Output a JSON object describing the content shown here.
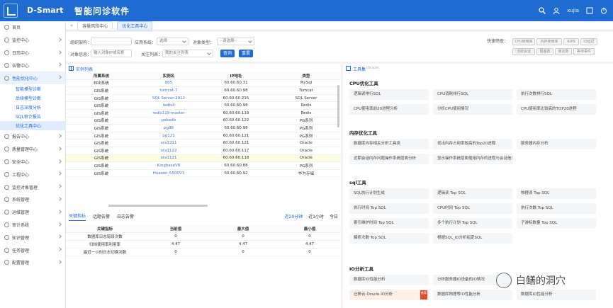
{
  "topbar": {
    "brand": "D-Smart",
    "title": "智能问诊软件",
    "user": "xujia"
  },
  "sidebar": {
    "items": [
      {
        "label": "首页"
      },
      {
        "label": "监控中心"
      },
      {
        "label": "日志中心"
      },
      {
        "label": "告警中心"
      },
      {
        "label": "性能优化中心",
        "active": true
      },
      {
        "label": "报告中心"
      },
      {
        "label": "质量管理中心"
      },
      {
        "label": "安全中心"
      },
      {
        "label": "工程中心"
      },
      {
        "label": "监控对象管理"
      },
      {
        "label": "系统管理"
      },
      {
        "label": "运维管理"
      },
      {
        "label": "审计系统"
      },
      {
        "label": "知识管理"
      },
      {
        "label": "任务管理"
      },
      {
        "label": "配置管理"
      }
    ],
    "subitems": [
      {
        "label": "智能模型诊断"
      },
      {
        "label": "后续模型诊断"
      },
      {
        "label": "日志深度分析"
      },
      {
        "label": "SQL审计报告"
      },
      {
        "label": "优化工具中心",
        "active": true
      }
    ]
  },
  "tabs": [
    {
      "label": "容量风险中心"
    },
    {
      "label": "优化工具中心",
      "active": true
    }
  ],
  "filters": {
    "org_label": "组织架构：",
    "app_label": "应用系统：",
    "app_value": "选择",
    "type_label": "对象类型：",
    "type_value": "--请选择--",
    "obj_label": "对象信息：",
    "obj_placeholder": "输入对象IP或名称",
    "focus_label": "关注列表：",
    "focus_value": "我的关注列表",
    "query_btn": "查询",
    "reset_btn": "重置",
    "quick_label": "快速筛查：",
    "quick": [
      "CPU使用率",
      "内存使用率",
      "IOPS",
      "IO延迟",
      "活跃会话",
      "阻塞数",
      "锁定数",
      "等待事件"
    ]
  },
  "instance_list": {
    "title": "实例列表",
    "headers": [
      "所属系统",
      "实例名",
      "IP地址",
      "类型"
    ],
    "rows": [
      [
        "ERP系统",
        "db5",
        "60.60.60.31",
        "MySql"
      ],
      [
        "GIS系统",
        "tomcat-7",
        "60.60.60.98",
        "Tomcat"
      ],
      [
        "GIS系统",
        "SQL Server-2012",
        "60.60.60.215",
        "SQL Server"
      ],
      [
        "GIS系统",
        "redis4",
        "60.60.60.98",
        "Redis"
      ],
      [
        "GIS系统",
        "redis119-master",
        "60.60.60.119",
        "Redis"
      ],
      [
        "GIS系统",
        "pekedb",
        "60.60.60.122",
        "PG系列"
      ],
      [
        "GIS系统",
        "pg98",
        "60.60.60.98",
        "PG系列"
      ],
      [
        "GIS系统",
        "pg121",
        "60.60.60.121",
        "PG系列"
      ],
      [
        "GIS系统",
        "ora1211",
        "60.60.60.121",
        "Oracle"
      ],
      [
        "GIS系统",
        "ora1122",
        "60.60.60.117",
        "Oracle"
      ],
      [
        "GIS系统",
        "ora1121",
        "60.60.60.118",
        "Oracle"
      ],
      [
        "GIS系统",
        "KingbaseV8",
        "60.60.60.88",
        "PG系列"
      ],
      [
        "GIS系统",
        "Huawei_5500V3",
        "60.60.60.92",
        "华为存储"
      ]
    ],
    "highlight_row": 10
  },
  "metrics": {
    "tabs": [
      "关键指标",
      "话题告警",
      "日志告警"
    ],
    "ranges": [
      "近20分钟",
      "近1小时",
      "今日"
    ],
    "headers": [
      "关键指标",
      "当前值",
      "最大值",
      "最小值"
    ],
    "rows": [
      [
        "数据库日志错误次数",
        "0",
        "0",
        "0"
      ],
      [
        "归档使用率利用率",
        "4.47",
        "4.47",
        "4.47"
      ],
      [
        "最近一小时日志切换次数",
        "0",
        "0",
        "0"
      ]
    ]
  },
  "tools": {
    "title": "工具集",
    "title_tag": "(Oracle)",
    "sections": [
      {
        "name": "CPU优化工具",
        "items": [
          "逻辑读排行SQL",
          "CPU消耗排行SQL",
          "执行次数排行SQL",
          "CPU使用率前20进程分析",
          "分析CPU使用情况",
          "CPU使用率比较高的TOP20进程"
        ]
      },
      {
        "name": "内存优化工具",
        "items": [
          "数据库内存相关分析工具类",
          "找出内存占用率较高的Top20进程",
          "服务器内存分析",
          "近期会话内存问题操作系统层面分析",
          "显示操作系统层面使用内存的进程与会话信息"
        ]
      },
      {
        "name": "sql工具",
        "items": [
          "SQL执行计划生成",
          "逻辑读 Top SQL",
          "物理读 Top SQL",
          "执行时间 Top SQL",
          "CPU时间 Top SQL",
          "执行次数 Top SQL",
          "索引维护时间 Top SQL",
          "多个执行计划 Top SQL",
          "子游标数量 Top SQL",
          "解析次数 Top SQL",
          "根据SQL_ID分析指定SQL"
        ]
      },
      {
        "name": "IO分析工具",
        "items": [
          "数据库IO性能分析",
          "分析服务器IO设备的IO情况",
          "",
          "迁移云-Oracle IO分析",
          "数据库物理等IO性能分析",
          "数据库IO性能分析"
        ]
      }
    ],
    "badge": "推荐"
  },
  "watermark": {
    "text": "白鳝的洞穴"
  }
}
